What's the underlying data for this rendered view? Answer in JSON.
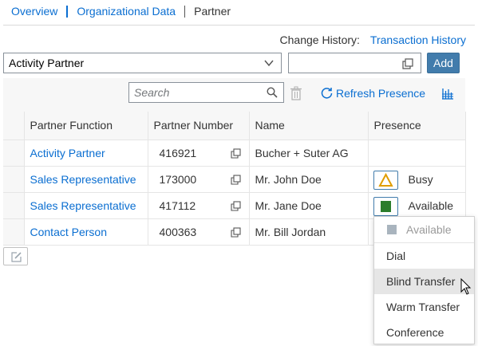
{
  "tabs": [
    {
      "label": "Overview"
    },
    {
      "label": "Organizational Data"
    },
    {
      "label": "Partner"
    }
  ],
  "change_history": {
    "label": "Change History:",
    "link": "Transaction History"
  },
  "partner_select": {
    "value": "Activity Partner",
    "icon": "chevron-down-icon"
  },
  "value_help": {
    "value": "",
    "icon": "value-help-icon"
  },
  "add_button": {
    "label": "Add"
  },
  "toolbar": {
    "search_placeholder": "Search",
    "refresh_label": "Refresh Presence"
  },
  "table": {
    "columns": [
      "Partner Function",
      "Partner Number",
      "Name",
      "Presence"
    ],
    "rows": [
      {
        "function": "Activity Partner",
        "number": "416921",
        "name": "Bucher + Suter AG",
        "presence": "",
        "presence_icon": ""
      },
      {
        "function": "Sales Representative",
        "number": "173000",
        "name": "Mr. John Doe",
        "presence": "Busy",
        "presence_icon": "warning-triangle-icon"
      },
      {
        "function": "Sales Representative",
        "number": "417112",
        "name": "Mr. Jane Doe",
        "presence": "Available",
        "presence_icon": "available-square-icon"
      },
      {
        "function": "Contact Person",
        "number": "400363",
        "name": "Mr. Bill Jordan",
        "presence": "",
        "presence_icon": ""
      }
    ]
  },
  "context_menu": {
    "status": "Available",
    "items": [
      "Dial",
      "Blind Transfer",
      "Warm Transfer",
      "Conference"
    ],
    "hovered": "Blind Transfer"
  },
  "colors": {
    "link": "#0a6ed1",
    "button": "#427cac",
    "busy": "#e09d00",
    "available": "#2b7d2b",
    "header_bg": "#f7f7f7"
  }
}
